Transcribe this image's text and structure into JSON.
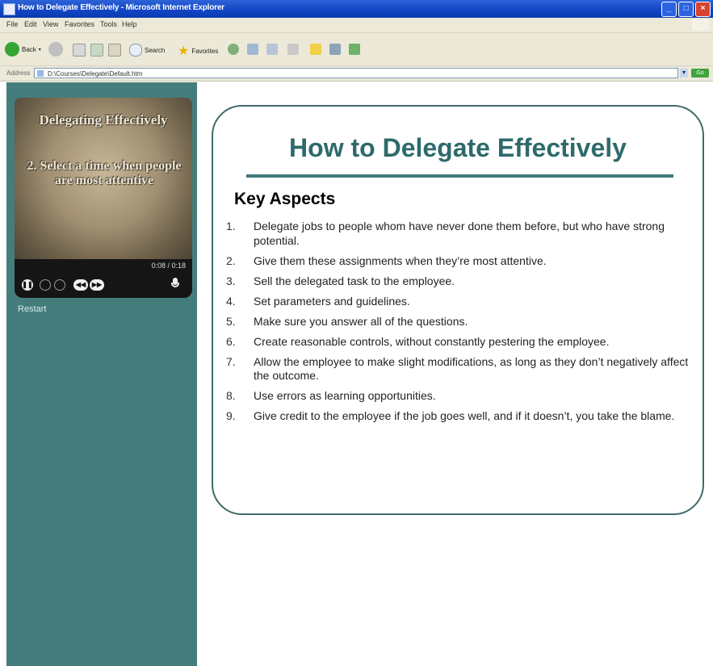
{
  "window": {
    "title": "How to Delegate Effectively - Microsoft Internet Explorer"
  },
  "menu": [
    "File",
    "Edit",
    "View",
    "Favorites",
    "Tools",
    "Help"
  ],
  "toolbar": {
    "back": "Back",
    "search": "Search",
    "favorites": "Favorites"
  },
  "address": {
    "label": "Address",
    "url": "D:\\Courses\\Delegate\\Default.htm",
    "go": "Go"
  },
  "player": {
    "slide_title": "Delegating Effectively",
    "slide_text": "2. Select a time when people are most attentive",
    "time": "0:08 / 0:18",
    "restart": "Restart"
  },
  "content": {
    "title": "How to Delegate Effectively",
    "section": "Key Aspects",
    "items": [
      {
        "num": "1.",
        "text": "Delegate jobs to people whom have never done them before, but who have strong potential."
      },
      {
        "num": "2.",
        "text": "Give them these assignments when they’re most attentive."
      },
      {
        "num": "3.",
        "text": "Sell the delegated task to the employee."
      },
      {
        "num": "4.",
        "text": "Set parameters and guidelines."
      },
      {
        "num": "5.",
        "text": "Make sure you answer all of the questions."
      },
      {
        "num": "6.",
        "text": "Create reasonable controls, without constantly pestering the employee."
      },
      {
        "num": "7.",
        "text": "Allow the employee to make slight modifications, as long as they don’t negatively affect the outcome."
      },
      {
        "num": "8.",
        "text": "Use errors as learning opportunities."
      },
      {
        "num": "9.",
        "text": "Give credit to the employee if the job goes well, and if it doesn’t, you take the blame."
      }
    ]
  },
  "colors": {
    "sidebar": "#447d7c",
    "accent": "#2e6a6b",
    "titlebar": "#1145c4"
  }
}
